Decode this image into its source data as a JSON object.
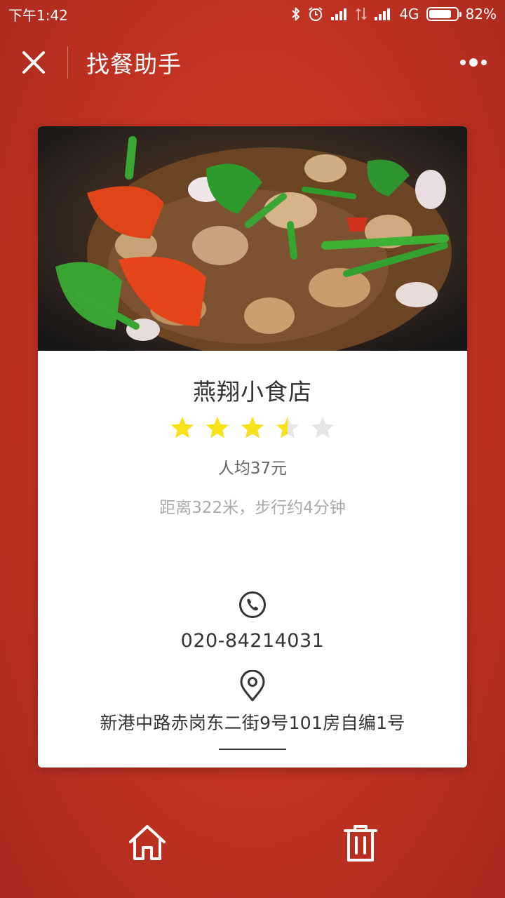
{
  "status_bar": {
    "time": "下午1:42",
    "network": "4G",
    "battery": "82%",
    "battery_level": 0.82
  },
  "nav": {
    "title": "找餐助手",
    "close_icon": "close-icon",
    "more_icon": "more-dots-icon"
  },
  "restaurant": {
    "name": "燕翔小食店",
    "rating": 3.5,
    "rating_max": 5,
    "avg_price": "人均37元",
    "distance": "距离322米，步行约4分钟",
    "phone": "020-84214031",
    "address": "新港中路赤岗东二街9号101房自编1号"
  },
  "colors": {
    "background": "#c73424",
    "star_active": "#f9e21c",
    "star_inactive": "#e6e6e6",
    "text_dark": "#333333",
    "text_light": "#aaaaaa"
  },
  "bottom_bar": {
    "home_icon": "home-icon",
    "delete_icon": "trash-icon"
  }
}
